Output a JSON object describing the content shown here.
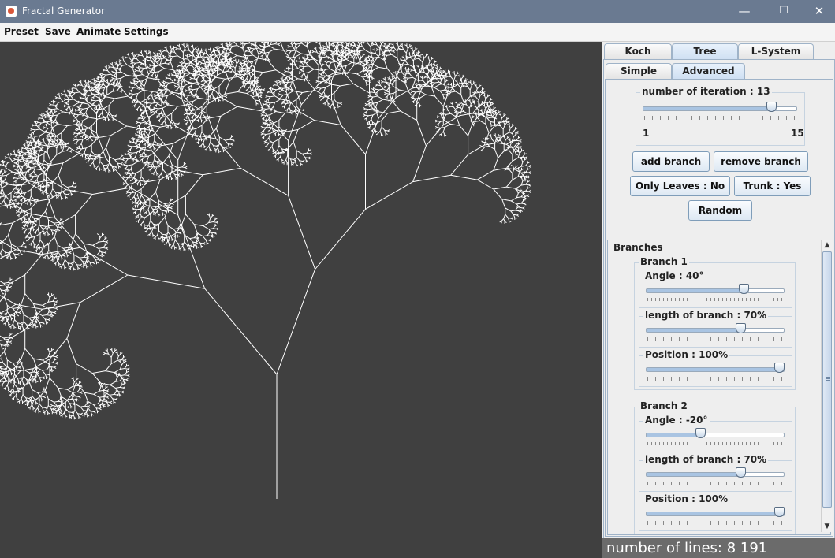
{
  "window": {
    "title": "Fractal Generator",
    "minimize": "—",
    "maximize": "☐",
    "close": "✕"
  },
  "menu": [
    "Preset",
    "Save",
    "Animate",
    "Settings"
  ],
  "tabs": [
    "Koch",
    "Tree",
    "L-System"
  ],
  "active_tab": "Tree",
  "subtabs": [
    "Simple",
    "Advanced"
  ],
  "active_subtab": "Advanced",
  "iteration": {
    "label": "number of iteration : 13",
    "value": 13,
    "min": 1,
    "max": 15,
    "min_label": "1",
    "max_label": "15"
  },
  "buttons": {
    "add_branch": "add branch",
    "remove_branch": "remove branch",
    "only_leaves": "Only Leaves : No",
    "trunk": "Trunk : Yes",
    "random": "Random"
  },
  "branches_title": "Branches",
  "branches": [
    {
      "name": "Branch 1",
      "angle_label": "Angle : 40°",
      "angle": 40,
      "length_label": "length of branch : 70%",
      "length": 70,
      "position_label": "Position : 100%",
      "position": 100
    },
    {
      "name": "Branch 2",
      "angle_label": "Angle : -20°",
      "angle": -20,
      "length_label": "length of branch : 70%",
      "length": 70,
      "position_label": "Position : 100%",
      "position": 100
    }
  ],
  "status": "number of lines: 8 191",
  "colors": {
    "titlebar": "#6a7a91",
    "canvas": "#404040",
    "fractal": "#ffffff",
    "status_bar": "#6b6b6b"
  }
}
